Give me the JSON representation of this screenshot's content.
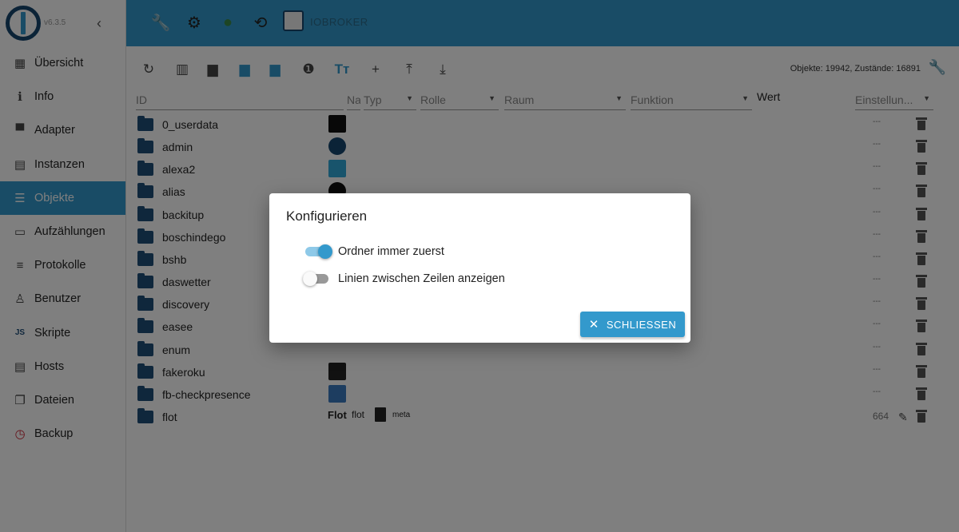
{
  "app": {
    "version": "v6.3.5",
    "host_name": "IOBROKER"
  },
  "sidebar": {
    "items": [
      {
        "label": "Übersicht",
        "icon": "grid-icon",
        "glyph": "▦"
      },
      {
        "label": "Info",
        "icon": "info-icon",
        "glyph": "ℹ"
      },
      {
        "label": "Adapter",
        "icon": "store-icon",
        "glyph": "▀"
      },
      {
        "label": "Instanzen",
        "icon": "instances-icon",
        "glyph": "▤"
      },
      {
        "label": "Objekte",
        "icon": "list-icon",
        "glyph": "☰",
        "active": true
      },
      {
        "label": "Aufzählungen",
        "icon": "enum-icon",
        "glyph": "▭"
      },
      {
        "label": "Protokolle",
        "icon": "log-icon",
        "glyph": "≡"
      },
      {
        "label": "Benutzer",
        "icon": "user-icon",
        "glyph": "♙"
      },
      {
        "label": "Skripte",
        "icon": "js-icon",
        "glyph": "JS"
      },
      {
        "label": "Hosts",
        "icon": "hosts-icon",
        "glyph": "▤"
      },
      {
        "label": "Dateien",
        "icon": "files-icon",
        "glyph": "❐"
      },
      {
        "label": "Backup",
        "icon": "backup-icon",
        "glyph": "◷"
      }
    ]
  },
  "toolbar": {
    "stats": "Objekte: 19942, Zustände: 16891"
  },
  "columns": {
    "id": "ID",
    "name": "Na",
    "typ": "Typ",
    "rolle": "Rolle",
    "raum": "Raum",
    "funktion": "Funktion",
    "wert": "Wert",
    "einstellungen": "Einstellun..."
  },
  "rows": [
    {
      "id": "0_userdata",
      "dash": "---"
    },
    {
      "id": "admin",
      "dash": "---"
    },
    {
      "id": "alexa2",
      "dash": "---"
    },
    {
      "id": "alias",
      "dash": "---"
    },
    {
      "id": "backitup",
      "dash": "---"
    },
    {
      "id": "boschindego",
      "dash": "---"
    },
    {
      "id": "bshb",
      "dash": "---"
    },
    {
      "id": "daswetter",
      "dash": "---"
    },
    {
      "id": "discovery",
      "dash": "---"
    },
    {
      "id": "easee",
      "dash": "---"
    },
    {
      "id": "enum",
      "dash": "---"
    },
    {
      "id": "fakeroku",
      "dash": "---"
    },
    {
      "id": "fb-checkpresence",
      "dash": "---"
    },
    {
      "id": "flot",
      "dash": "664",
      "name_logo": "Flot",
      "name": "flot",
      "type": "meta"
    }
  ],
  "dialog": {
    "title": "Konfigurieren",
    "option1": "Ordner immer zuerst",
    "option1_on": true,
    "option2": "Linien zwischen Zeilen anzeigen",
    "option2_on": false,
    "close_label": "SCHLIESSEN"
  },
  "colors": {
    "accent": "#3399cc",
    "folder": "#1f4e79"
  }
}
